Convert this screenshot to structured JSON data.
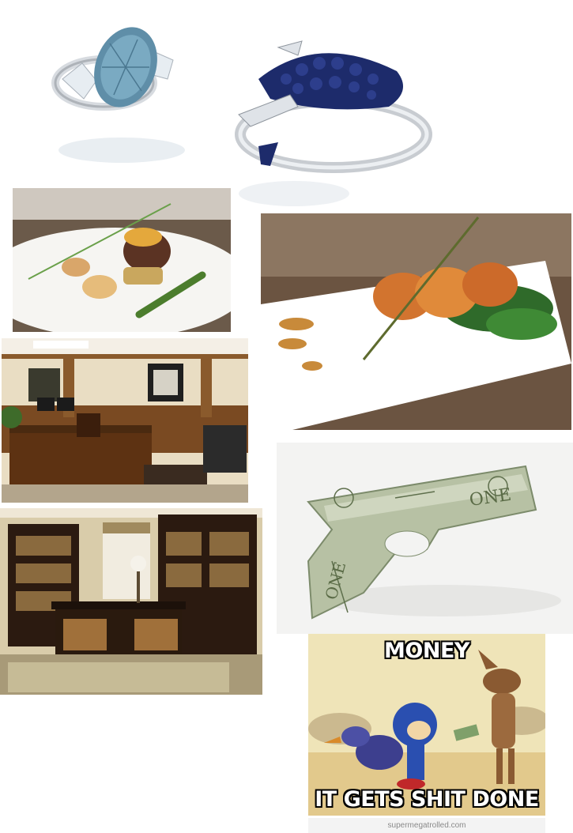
{
  "collage": {
    "tiles": [
      {
        "id": "blue-diamond-ring",
        "icon": "ring-photo"
      },
      {
        "id": "sapphire-dolphin-ring",
        "icon": "ring-photo"
      },
      {
        "id": "scallop-dish",
        "icon": "food-photo"
      },
      {
        "id": "fish-cake-dish",
        "icon": "food-photo"
      },
      {
        "id": "wood-office",
        "icon": "office-photo"
      },
      {
        "id": "home-office",
        "icon": "office-photo"
      },
      {
        "id": "dollar-origami-gun",
        "icon": "money-gun-photo"
      },
      {
        "id": "money-meme",
        "icon": "cartoon-meme"
      }
    ]
  },
  "meme": {
    "top_text": "MONEY",
    "bottom_text": "IT GETS SHIT DONE",
    "credit": "supermegatrolled.com"
  },
  "colors": {
    "background": "#ffffff",
    "meme_text": "#ffffff",
    "meme_outline": "#000000"
  }
}
